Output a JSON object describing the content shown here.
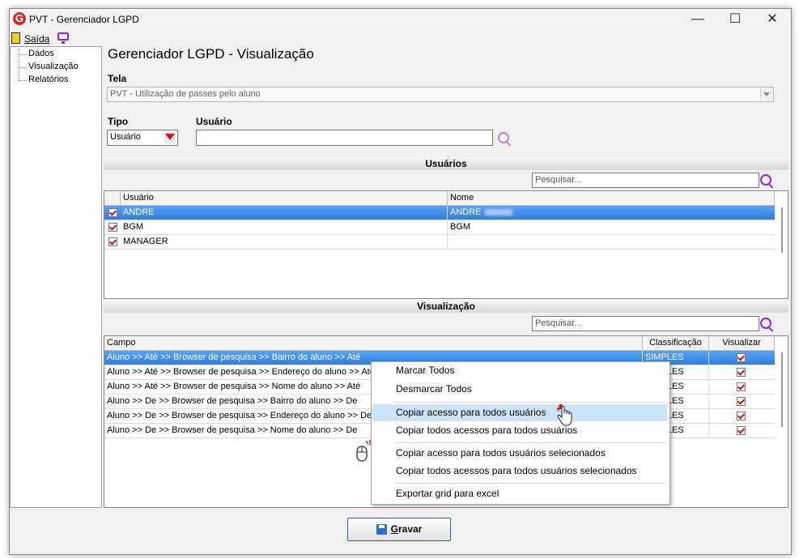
{
  "window": {
    "title": "PVT - Gerenciador LGPD",
    "logo_letter": "G",
    "controls": {
      "minimize": "—",
      "maximize": "☐",
      "close": "✕"
    }
  },
  "menu": {
    "exit_label": "Saída"
  },
  "tree": {
    "items": [
      "Dados",
      "Visualização",
      "Relatórios"
    ]
  },
  "page_title": "Gerenciador LGPD - Visualização",
  "tela": {
    "label": "Tela",
    "value": "PVT - Utilização de passes pelo aluno"
  },
  "tipo": {
    "label": "Tipo",
    "value": "Usuário"
  },
  "usuario": {
    "label": "Usuário",
    "value": ""
  },
  "users_section": {
    "title": "Usuários",
    "search_placeholder": "Pesquisar...",
    "columns": [
      "Usuário",
      "Nome"
    ],
    "rows": [
      {
        "user": "ANDRE",
        "name": "ANDRE",
        "checked": true,
        "selected": true
      },
      {
        "user": "BGM",
        "name": "BGM",
        "checked": true,
        "selected": false
      },
      {
        "user": "MANAGER",
        "name": "",
        "checked": true,
        "selected": false
      }
    ]
  },
  "view_section": {
    "title": "Visualização",
    "search_placeholder": "Pesquisar...",
    "columns": [
      "Campo",
      "Classificação",
      "Visualizar"
    ],
    "rows": [
      {
        "campo": "Aluno >> Até >> Browser de pesquisa >> Bairro do aluno >> Até",
        "class": "SIMPLES",
        "checked": true,
        "selected": true
      },
      {
        "campo": "Aluno >> Até >> Browser de pesquisa >> Endereço do aluno >> Até",
        "class": "SIMPLES",
        "checked": true,
        "selected": false
      },
      {
        "campo": "Aluno >> Até >> Browser de pesquisa >> Nome do aluno >> Até",
        "class": "SIMPLES",
        "checked": true,
        "selected": false
      },
      {
        "campo": "Aluno >> De >> Browser de pesquisa >> Bairro do aluno >> De",
        "class": "SIMPLES",
        "checked": true,
        "selected": false
      },
      {
        "campo": "Aluno >> De >> Browser de pesquisa >> Endereço do aluno >> De",
        "class": "SIMPLES",
        "checked": true,
        "selected": false
      },
      {
        "campo": "Aluno >> De >> Browser de pesquisa >> Nome do aluno >> De",
        "class": "SIMPLES",
        "checked": true,
        "selected": false
      }
    ]
  },
  "context_menu": {
    "items": [
      "Marcar Todos",
      "Desmarcar Todos",
      "Copiar acesso para todos usuários",
      "Copiar todos acessos para todos usuários",
      "Copiar acesso para todos usuários selecionados",
      "Copiar todos acessos para todos usuários selecionados",
      "Exportar grid para excel"
    ],
    "highlighted_index": 2
  },
  "footer": {
    "save_label": "Gravar",
    "save_underline": "G",
    "save_rest": "ravar"
  },
  "colors": {
    "selection": "#2f7fe0",
    "menu_highlight": "#cce4f7",
    "accent": "#8a2bd6",
    "check": "#d01414"
  }
}
